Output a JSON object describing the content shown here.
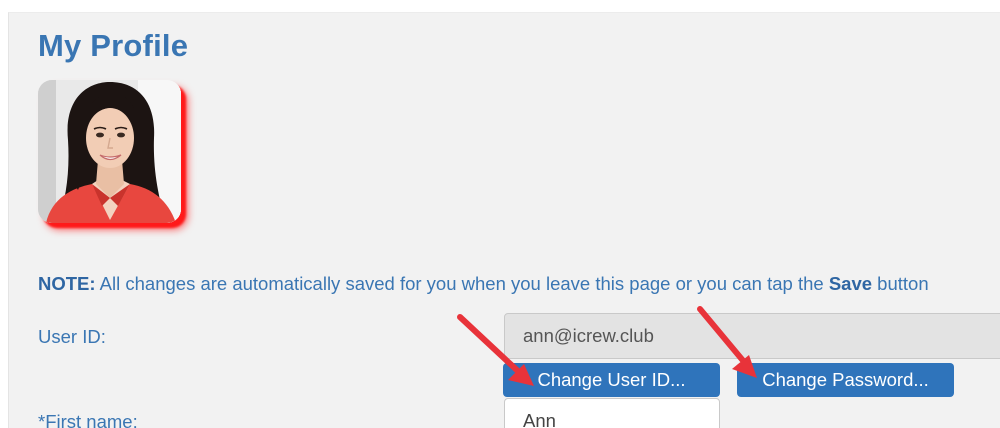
{
  "page": {
    "title": "My Profile"
  },
  "profile": {
    "avatar_label": "profile-photo"
  },
  "note": {
    "prefix": "NOTE:",
    "text_before_save": " All changes are automatically saved for you when you leave this page or you can tap the ",
    "save_word": "Save",
    "text_after_save": " button"
  },
  "fields": {
    "user_id_label": "User ID:",
    "user_id_value": "ann@icrew.club",
    "first_name_label": "*First name:",
    "first_name_value": "Ann"
  },
  "buttons": {
    "change_user_id": "Change User ID...",
    "change_password": "Change Password..."
  },
  "annotations": {
    "arrow_color": "#e8333a"
  },
  "colors": {
    "heading": "#3a76b3",
    "button": "#2f74bb",
    "panel": "#f2f2f2",
    "avatar_glow": "#ff1a1a"
  }
}
